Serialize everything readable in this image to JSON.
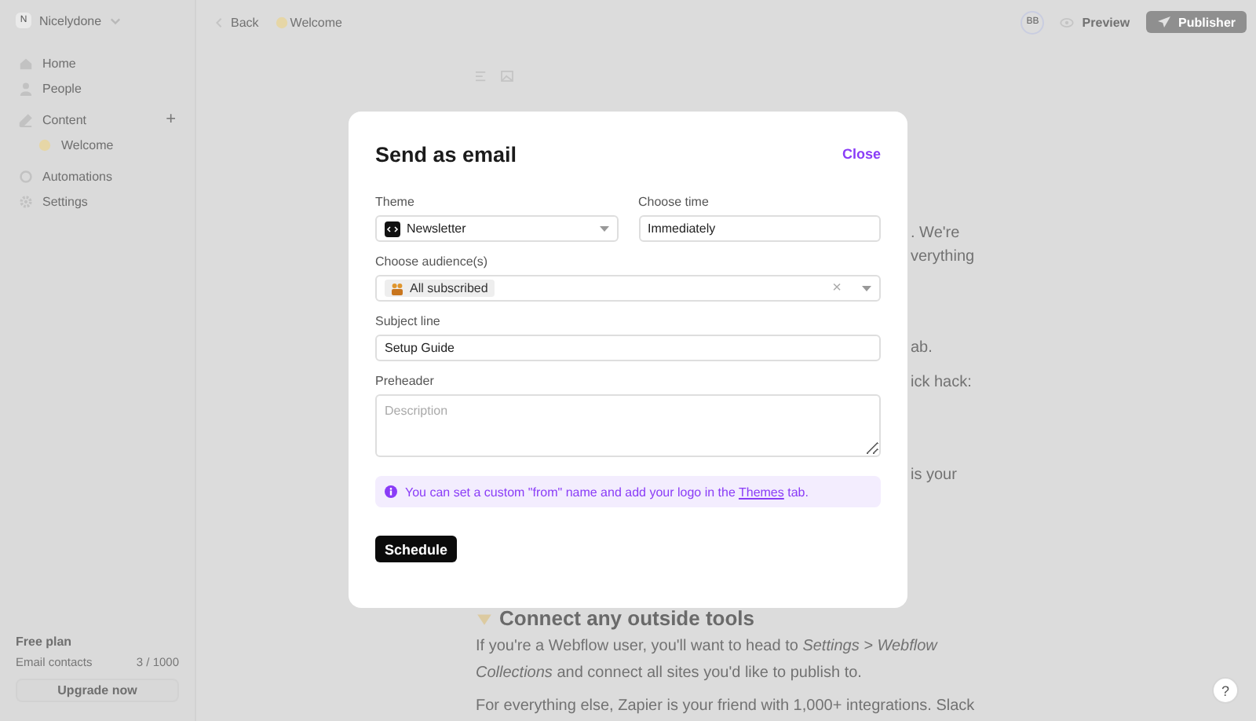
{
  "sidebar": {
    "workspace": {
      "initial": "N",
      "name": "Nicelydone"
    },
    "items": [
      {
        "label": "Home",
        "selected": false
      },
      {
        "label": "People",
        "selected": false
      },
      {
        "label": "Content",
        "selected": false,
        "add": "+",
        "children": [
          {
            "label": "Welcome",
            "selected": false
          }
        ]
      },
      {
        "label": "Automations",
        "selected": false
      },
      {
        "label": "Settings",
        "selected": false
      }
    ],
    "plan": {
      "title": "Free plan",
      "usage_label": "Email contacts",
      "usage_value": "3 / 1000",
      "upgrade": "Upgrade now"
    }
  },
  "topbar": {
    "back": "Back",
    "page": "Welcome",
    "avatar": "BB",
    "preview": "Preview",
    "publish": "Publisher"
  },
  "document": {
    "partial_lines": [
      ". We're",
      "verything",
      "ab.",
      "ick hack:",
      "is your"
    ],
    "heading": "Connect any outside tools",
    "paragraphs": [
      "If you're a Webflow user, you'll want to head to *Settings > Webflow Collections* and connect all sites you'd like to publish to.",
      "For everything else, Zapier is your friend with 1,000+ integrations. Slack"
    ]
  },
  "modal": {
    "title": "Send as email",
    "close": "Close",
    "theme": {
      "label": "Theme",
      "value": "Newsletter"
    },
    "time": {
      "label": "Choose time",
      "value": "Immediately"
    },
    "audience": {
      "label": "Choose audience(s)",
      "chips": [
        "All subscribed"
      ],
      "clear": "×"
    },
    "subject": {
      "label": "Subject line",
      "value": "Setup Guide"
    },
    "preheader": {
      "label": "Preheader",
      "placeholder": "Description"
    },
    "info": {
      "before": "You can set a custom \"from\" name and add your logo in the ",
      "link": "Themes",
      "after": " tab."
    },
    "submit": "Schedule"
  },
  "help": "?"
}
